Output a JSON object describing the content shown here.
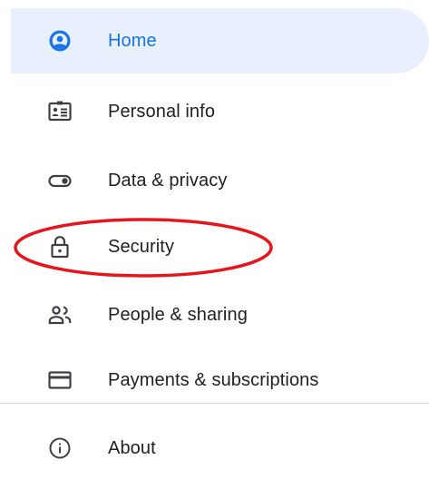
{
  "nav": {
    "items": [
      {
        "label": "Home",
        "icon": "account-circle-icon",
        "active": true
      },
      {
        "label": "Personal info",
        "icon": "id-card-icon"
      },
      {
        "label": "Data & privacy",
        "icon": "toggle-icon"
      },
      {
        "label": "Security",
        "icon": "lock-icon"
      },
      {
        "label": "People & sharing",
        "icon": "people-icon"
      },
      {
        "label": "Payments & subscriptions",
        "icon": "credit-card-icon"
      }
    ],
    "footer_items": [
      {
        "label": "About",
        "icon": "info-icon"
      }
    ]
  },
  "colors": {
    "active_bg": "#e8f0fe",
    "active_text": "#1a73e8",
    "text": "#202124",
    "icon": "#3c4043",
    "divider": "#dadce0",
    "annotation": "#e8141c"
  },
  "annotation": {
    "shape": "ellipse",
    "target": "Security"
  }
}
